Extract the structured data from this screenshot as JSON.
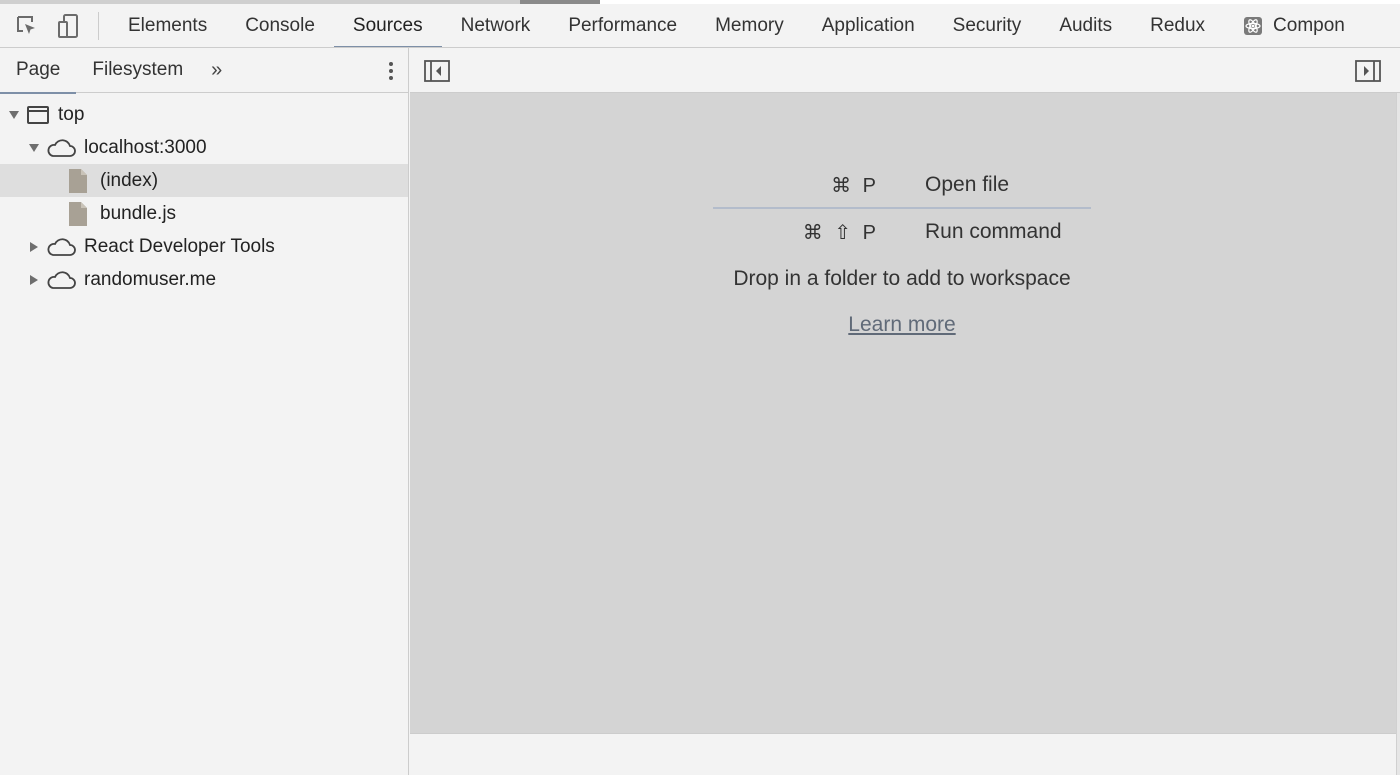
{
  "toolbar": {
    "tabs": [
      {
        "label": "Elements"
      },
      {
        "label": "Console"
      },
      {
        "label": "Sources"
      },
      {
        "label": "Network"
      },
      {
        "label": "Performance"
      },
      {
        "label": "Memory"
      },
      {
        "label": "Application"
      },
      {
        "label": "Security"
      },
      {
        "label": "Audits"
      },
      {
        "label": "Redux"
      },
      {
        "label": "Compon"
      }
    ],
    "active_tab": "Sources",
    "icons": [
      "inspect-element-icon",
      "device-toolbar-icon",
      "react-icon"
    ]
  },
  "sidebar": {
    "tabs": [
      {
        "label": "Page"
      },
      {
        "label": "Filesystem"
      }
    ],
    "more_label": "»",
    "tree": [
      {
        "label": "top",
        "icon": "frame-icon",
        "expanded": true
      },
      {
        "label": "localhost:3000",
        "icon": "cloud-icon",
        "expanded": true
      },
      {
        "label": "(index)",
        "icon": "file-icon",
        "selected": true
      },
      {
        "label": "bundle.js",
        "icon": "file-icon"
      },
      {
        "label": "React Developer Tools",
        "icon": "cloud-icon",
        "expanded": false
      },
      {
        "label": "randomuser.me",
        "icon": "cloud-icon",
        "expanded": false
      }
    ]
  },
  "editor": {
    "shortcuts": [
      {
        "keys": "⌘ P",
        "label": "Open file"
      },
      {
        "keys": "⌘ ⇧ P",
        "label": "Run command"
      }
    ],
    "drop_text": "Drop in a folder to add to workspace",
    "learn_more": "Learn more"
  },
  "colors": {
    "accent": "#7d8fa7",
    "editor_bg": "#d4d4d4",
    "panel_bg": "#f3f3f3",
    "selected_row": "#dedede"
  }
}
